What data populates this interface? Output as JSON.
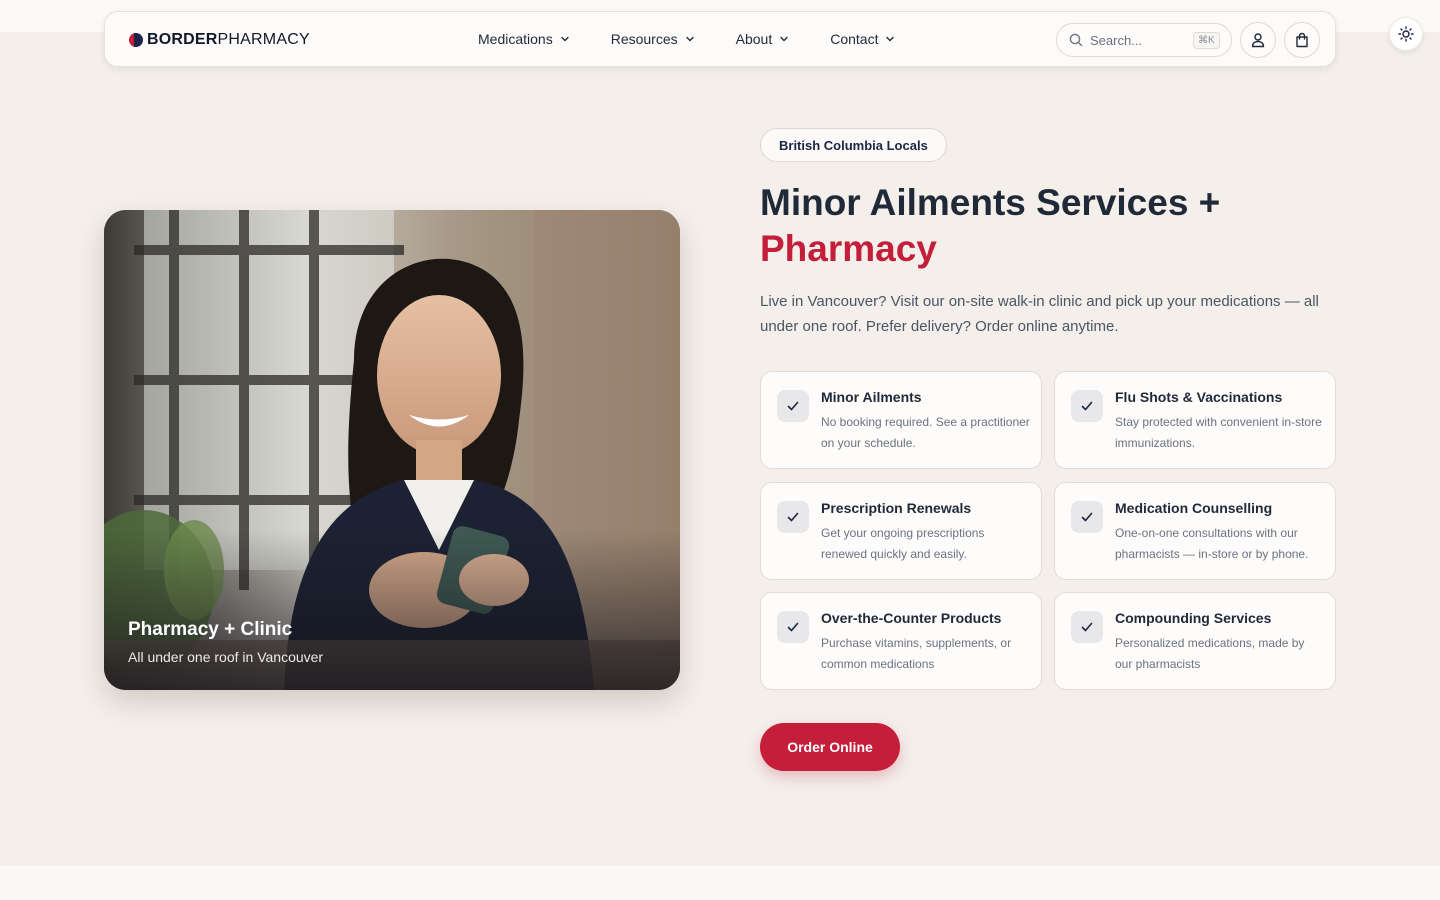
{
  "brand": {
    "name_bold": "BORDER",
    "name_light": "PHARMACY",
    "accent": "#c41e3a",
    "navy": "#1b2545"
  },
  "nav": {
    "items": [
      {
        "label": "Medications"
      },
      {
        "label": "Resources"
      },
      {
        "label": "About"
      },
      {
        "label": "Contact"
      }
    ]
  },
  "search": {
    "placeholder": "Search...",
    "shortcut": "⌘K"
  },
  "header_icons": {
    "account": "user-icon",
    "cart": "shopping-bag-icon",
    "theme": "sun-icon"
  },
  "hero": {
    "image": "photo-woman-smiling-at-phone",
    "caption_title": "Pharmacy + Clinic",
    "caption_subtitle": "All under one roof in Vancouver"
  },
  "content": {
    "pill": "British Columbia Locals",
    "headline_main": "Minor Ailments Services +",
    "headline_accent": "Pharmacy",
    "lead": "Live in Vancouver? Visit our on-site walk-in clinic and pick up your medications — all under one roof. Prefer delivery? Order online anytime.",
    "services": [
      {
        "title": "Minor Ailments",
        "desc": "No booking required. See a practitioner on your schedule."
      },
      {
        "title": "Flu Shots & Vaccinations",
        "desc": "Stay protected with convenient in-store immunizations."
      },
      {
        "title": "Prescription Renewals",
        "desc": "Get your ongoing prescriptions renewed quickly and easily."
      },
      {
        "title": "Medication Counselling",
        "desc": "One-on-one consultations with our pharmacists — in-store or by phone."
      },
      {
        "title": "Over-the-Counter Products",
        "desc": "Purchase vitamins, supplements, or common medications"
      },
      {
        "title": "Compounding Services",
        "desc": "Personalized medications, made by our pharmacists"
      }
    ],
    "cta": "Order Online"
  }
}
